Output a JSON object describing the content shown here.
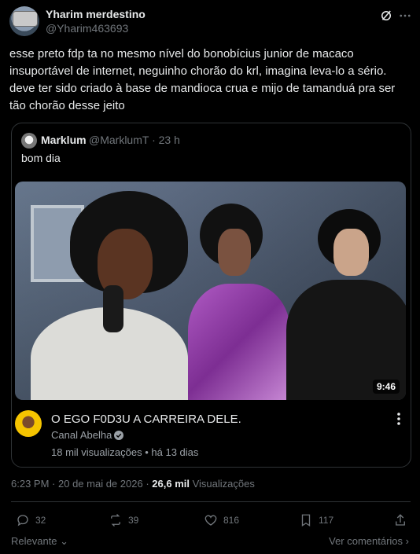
{
  "post": {
    "author_name": "Yharim merdestino",
    "author_handle": "@Yharim463693",
    "text": "esse preto fdp ta no mesmo nível do bonobícius junior de macaco insuportável de internet, neguinho chorão do krl, imagina leva-lo a sério. deve ter sido criado à base de mandioca crua e mijo de tamanduá pra ser tão chorão desse jeito",
    "time": "6:23 PM",
    "date": "20 de mai de 2026",
    "views_count": "26,6 mil",
    "views_label": "Visualizações"
  },
  "quote": {
    "author_name": "Marklum",
    "author_handle": "@MarklumT",
    "time_ago": "23 h",
    "text": "bom dia",
    "video": {
      "duration": "9:46",
      "title": "O EGO F0D3U A CARREIRA DELE.",
      "channel": "Canal Abelha",
      "views": "18 mil visualizações",
      "uploaded": "há 13 dias"
    }
  },
  "actions": {
    "replies": "32",
    "reposts": "39",
    "likes": "816",
    "bookmarks": "117"
  },
  "footer": {
    "sort_label": "Relevante",
    "view_replies": "Ver comentários"
  },
  "icons": [
    "grok-icon",
    "more-icon",
    "reply-icon",
    "repost-icon",
    "like-icon",
    "bookmark-icon",
    "share-icon",
    "verified-icon",
    "chevron-down-icon",
    "chevron-right-icon"
  ],
  "colors": {
    "background": "#000000",
    "text": "#e7e9ea",
    "secondary": "#71767b",
    "border": "#2f3336"
  }
}
